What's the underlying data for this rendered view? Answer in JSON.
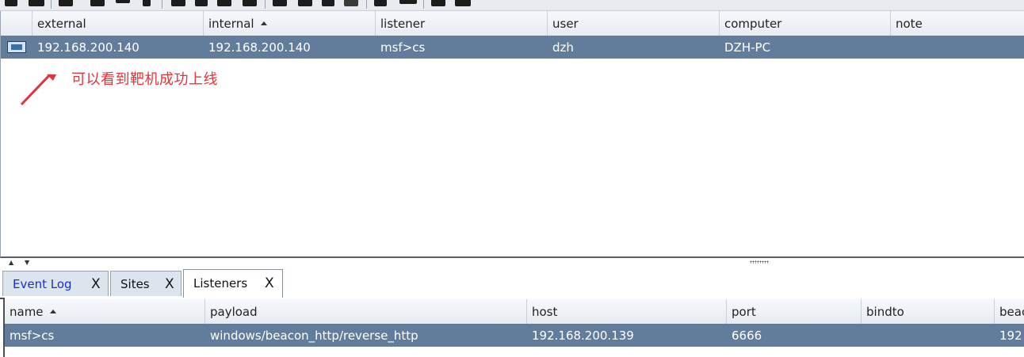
{
  "colors": {
    "selection": "#617d9b",
    "annotation": "#e2343b",
    "tab_link": "#1a2fd0"
  },
  "toolbar": {
    "icons": [
      "toolbar-icon-1",
      "toolbar-icon-2",
      "toolbar-icon-3",
      "toolbar-icon-4",
      "toolbar-icon-5",
      "toolbar-icon-6",
      "toolbar-icon-7",
      "toolbar-icon-8",
      "toolbar-icon-9",
      "toolbar-icon-10",
      "toolbar-icon-11",
      "toolbar-icon-12",
      "toolbar-icon-13",
      "toolbar-icon-14",
      "toolbar-icon-15",
      "toolbar-icon-16",
      "toolbar-icon-17"
    ]
  },
  "beacons": {
    "columns": [
      "external",
      "internal",
      "listener",
      "user",
      "computer",
      "note"
    ],
    "sorted_column": "internal",
    "rows": [
      {
        "icon": "monitor-icon",
        "external": "192.168.200.140",
        "internal": "192.168.200.140",
        "listener": "msf>cs",
        "user": "dzh",
        "computer": "DZH-PC",
        "note": ""
      }
    ]
  },
  "annotation": {
    "text": "可以看到靶机成功上线"
  },
  "tabs": [
    {
      "label": "Event Log",
      "close": "X"
    },
    {
      "label": "Sites",
      "close": "X"
    },
    {
      "label": "Listeners",
      "close": "X",
      "active": true
    }
  ],
  "listeners": {
    "columns": [
      "name",
      "payload",
      "host",
      "port",
      "bindto",
      "beac"
    ],
    "sorted_column": "name",
    "rows": [
      {
        "name": "msf>cs",
        "payload": "windows/beacon_http/reverse_http",
        "host": "192.168.200.139",
        "port": "6666",
        "bindto": "",
        "beacons": "192"
      }
    ]
  }
}
